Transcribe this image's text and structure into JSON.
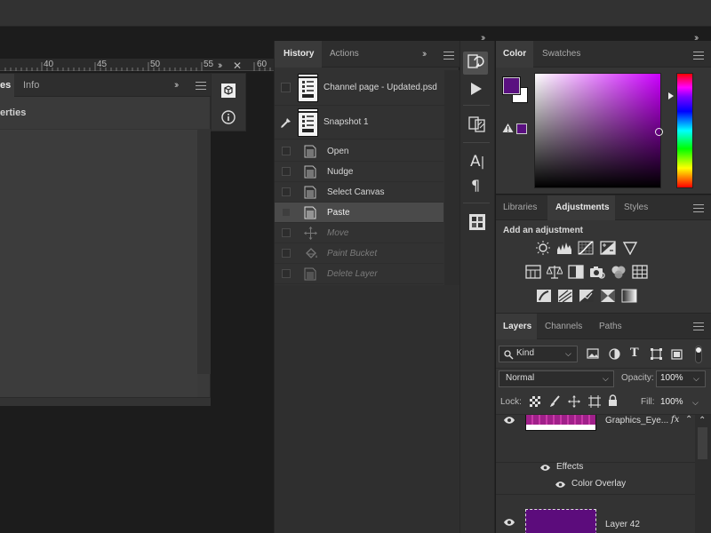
{
  "ruler": {
    "ticks": [
      "40",
      "45",
      "50",
      "55",
      "60"
    ]
  },
  "left_panel": {
    "tabs": [
      "es",
      "Info"
    ],
    "subtitle": "erties"
  },
  "history": {
    "tabs": [
      "History",
      "Actions"
    ],
    "snapshots": [
      {
        "label": "Channel page - Updated.psd"
      },
      {
        "label": "Snapshot 1"
      }
    ],
    "steps": [
      {
        "label": "Open",
        "icon": "document-icon",
        "state": "done"
      },
      {
        "label": "Nudge",
        "icon": "document-icon",
        "state": "done"
      },
      {
        "label": "Select Canvas",
        "icon": "document-icon",
        "state": "done"
      },
      {
        "label": "Paste",
        "icon": "document-icon",
        "state": "selected"
      },
      {
        "label": "Move",
        "icon": "move-icon",
        "state": "undone"
      },
      {
        "label": "Paint Bucket",
        "icon": "paint-bucket-icon",
        "state": "undone"
      },
      {
        "label": "Delete Layer",
        "icon": "document-icon",
        "state": "undone"
      }
    ]
  },
  "color_panel": {
    "tabs": [
      "Color",
      "Swatches"
    ],
    "foreground": "#5a1080",
    "background": "#ffffff",
    "hue_color": "#cc00ff"
  },
  "adjustments_panel": {
    "tabs": [
      "Libraries",
      "Adjustments",
      "Styles"
    ],
    "heading": "Add an adjustment"
  },
  "layers_panel": {
    "tabs": [
      "Layers",
      "Channels",
      "Paths"
    ],
    "filter_kind": "Kind",
    "blend_mode": "Normal",
    "opacity_label": "Opacity:",
    "opacity_value": "100%",
    "lock_label": "Lock:",
    "fill_label": "Fill:",
    "fill_value": "100%",
    "layers": [
      {
        "name": "Graphics_Eye...",
        "fx": "fx"
      },
      {
        "name": "Layer 42"
      }
    ],
    "effects_label": "Effects",
    "effect_item": "Color Overlay"
  },
  "colors": {
    "accent_purple": "#5a1080"
  }
}
